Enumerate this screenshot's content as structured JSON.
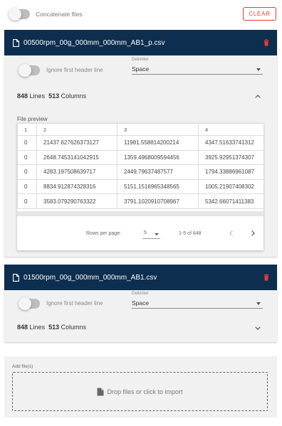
{
  "top": {
    "concatenate_label": "Concatenate files",
    "clear_label": "CLEAR"
  },
  "files": [
    {
      "filename": "00500rpm_00g_000mm_000mm_AB1_p.csv",
      "ignore_header_label": "Ignore first header line",
      "delimiter_label": "Delimiter",
      "delimiter_value": "Space",
      "lines_count": "848",
      "lines_label": "Lines",
      "columns_count": "513",
      "columns_label": "Columns",
      "expanded": true,
      "preview": {
        "label": "File preview",
        "headers": [
          "1",
          "2",
          "3",
          "4"
        ],
        "rows": [
          [
            "0",
            "21437.627626373127",
            "11981.558814200214",
            "4347.51633741312"
          ],
          [
            "0",
            "2648.7453141042915",
            "1359.4968009594456",
            "3925.92951374307"
          ],
          [
            "0",
            "4283.197508639717",
            "2449.79637487577",
            "1794.33886961087"
          ],
          [
            "0",
            "8834.912874328316",
            "5151.1516965348565",
            "1005.21907408302"
          ],
          [
            "0",
            "3583.079290763322",
            "3791.1020910708967",
            "5342.66071411383"
          ]
        ],
        "rows_per_page_label": "Rows per page:",
        "rows_per_page_value": "5",
        "range_text": "1-5 of 848"
      }
    },
    {
      "filename": "01500rpm_00g_000mm_000mm_AB1.csv",
      "ignore_header_label": "Ignore first header line",
      "delimiter_label": "Delimiter",
      "delimiter_value": "Space",
      "lines_count": "848",
      "lines_label": "Lines",
      "columns_count": "513",
      "columns_label": "Columns",
      "expanded": false
    }
  ],
  "add_files": {
    "label": "Add file(s)",
    "drop_text": "Drop files or click to import"
  },
  "colors": {
    "header_bg": "#0d2e4f",
    "accent_red": "#e53935",
    "card_bg": "#f1f1f1"
  },
  "icons": [
    "file-icon",
    "trash-icon",
    "chevron-up-icon",
    "chevron-down-icon",
    "chevron-left-icon",
    "chevron-right-icon",
    "dropdown-caret-icon"
  ]
}
